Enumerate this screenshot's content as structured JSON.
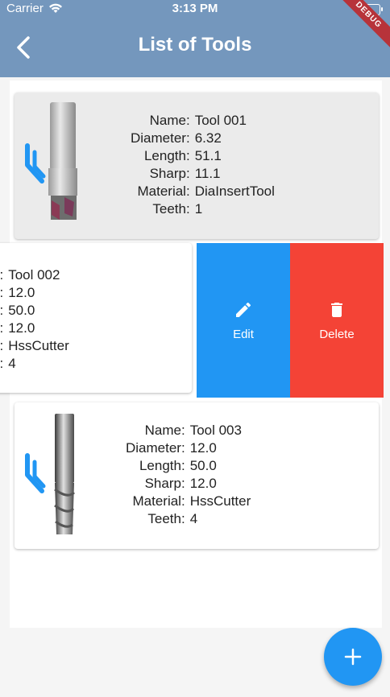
{
  "status_bar": {
    "carrier": "Carrier",
    "time": "3:13 PM"
  },
  "app_bar": {
    "title": "List of Tools",
    "debug_banner": "DEBUG"
  },
  "colors": {
    "app_bar": "#7497bd",
    "edit": "#2196f3",
    "delete": "#f44336",
    "fab": "#2196f3"
  },
  "tools": [
    {
      "labels": [
        "Name:",
        "Diameter:",
        "Length:",
        "Sharp:",
        "Material:",
        "Teeth:"
      ],
      "values": [
        "Tool 001",
        "6.32",
        "51.1",
        "11.1",
        "DiaInsertTool",
        "1"
      ]
    },
    {
      "labels": [
        "e:",
        "r:",
        "h:",
        "p:",
        "l:",
        "h:"
      ],
      "values": [
        "Tool 002",
        "12.0",
        "50.0",
        "12.0",
        "HssCutter",
        "4"
      ]
    },
    {
      "labels": [
        "Name:",
        "Diameter:",
        "Length:",
        "Sharp:",
        "Material:",
        "Teeth:"
      ],
      "values": [
        "Tool 003",
        "12.0",
        "50.0",
        "12.0",
        "HssCutter",
        "4"
      ]
    }
  ],
  "swipe_actions": {
    "edit_label": "Edit",
    "delete_label": "Delete"
  },
  "icons": {
    "back": "chevron-left-icon",
    "edit": "pencil-icon",
    "delete": "trash-icon",
    "add": "plus-icon"
  }
}
